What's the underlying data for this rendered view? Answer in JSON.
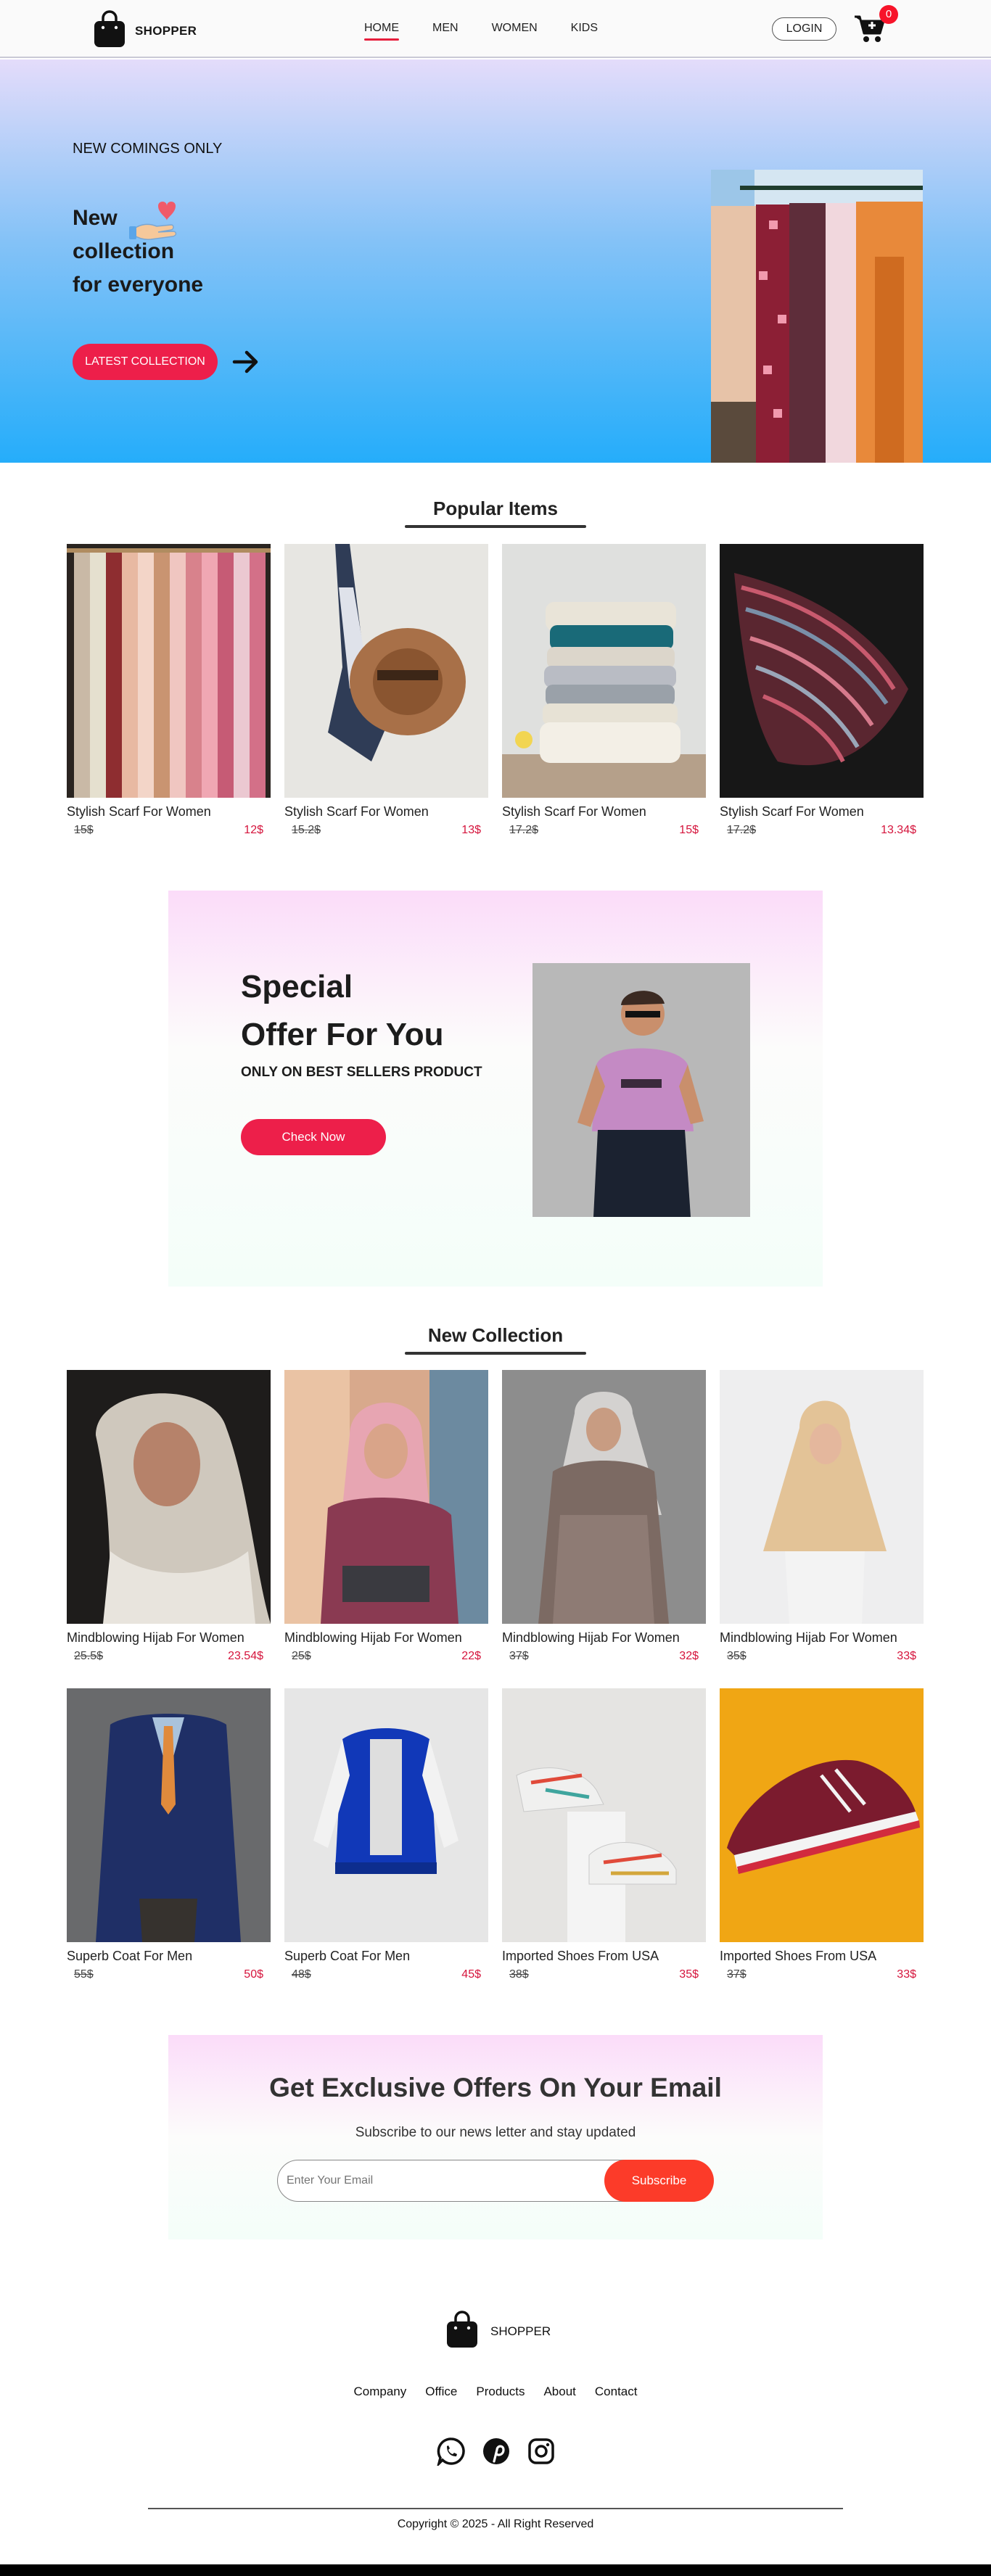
{
  "nav": {
    "brand": "SHOPPER",
    "menu": [
      "HOME",
      "MEN",
      "WOMEN",
      "KIDS"
    ],
    "active_menu": "HOME",
    "login_label": "LOGIN",
    "cart_count": "0",
    "accent_color": "#e61e3c"
  },
  "hero": {
    "eyebrow": "NEW COMINGS ONLY",
    "headline_line1": "New",
    "headline_line2": "collection",
    "headline_line3": "for everyone",
    "cta_label": "LATEST COLLECTION",
    "icons": [
      "hand-heart-icon",
      "arrow-right-icon"
    ]
  },
  "popular": {
    "title": "Popular Items",
    "items": [
      {
        "name": "Stylish Scarf For Women",
        "old_price": "15$",
        "new_price": "12$",
        "image": "scarves-on-rack"
      },
      {
        "name": "Stylish Scarf For Women",
        "old_price": "15.2$",
        "new_price": "13$",
        "image": "hat-and-scarf"
      },
      {
        "name": "Stylish Scarf For Women",
        "old_price": "17.2$",
        "new_price": "15$",
        "image": "folded-knits"
      },
      {
        "name": "Stylish Scarf For Women",
        "old_price": "17.2$",
        "new_price": "13.34$",
        "image": "striped-scarf"
      }
    ]
  },
  "offer": {
    "line1": "Special",
    "line2": "Offer For You",
    "sub": "ONLY ON BEST SELLERS PRODUCT",
    "cta_label": "Check Now"
  },
  "new_collection": {
    "title": "New Collection",
    "row1": [
      {
        "name": "Mindblowing Hijab For Women",
        "old_price": "25.5$",
        "new_price": "23.54$"
      },
      {
        "name": "Mindblowing Hijab For Women",
        "old_price": "25$",
        "new_price": "22$"
      },
      {
        "name": "Mindblowing Hijab For Women",
        "old_price": "37$",
        "new_price": "32$"
      },
      {
        "name": "Mindblowing Hijab For Women",
        "old_price": "35$",
        "new_price": "33$"
      }
    ],
    "row2": [
      {
        "name": "Superb Coat For Men",
        "old_price": "55$",
        "new_price": "50$"
      },
      {
        "name": "Superb Coat For Men",
        "old_price": "48$",
        "new_price": "45$"
      },
      {
        "name": "Imported Shoes From USA",
        "old_price": "38$",
        "new_price": "35$"
      },
      {
        "name": "Imported Shoes From USA",
        "old_price": "37$",
        "new_price": "33$"
      }
    ]
  },
  "newsletter": {
    "title": "Get Exclusive Offers On Your Email",
    "subtitle": "Subscribe to our news letter and stay updated",
    "placeholder": "Enter Your Email",
    "button_label": "Subscribe",
    "button_color": "#fc3b29"
  },
  "footer": {
    "brand": "SHOPPER",
    "links": [
      "Company",
      "Office",
      "Products",
      "About",
      "Contact"
    ],
    "social": [
      "whatsapp-icon",
      "pinterest-icon",
      "instagram-icon"
    ],
    "copyright": "Copyright © 2025 - All Right Reserved"
  }
}
